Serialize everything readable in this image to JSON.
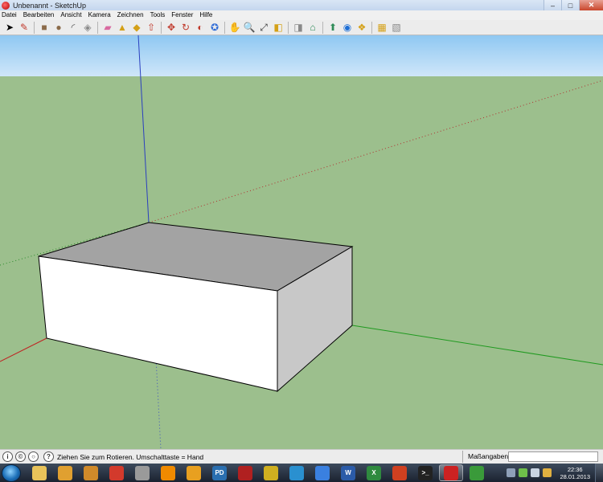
{
  "window": {
    "title": "Unbenannt - SketchUp",
    "minimize_glyph": "–",
    "maximize_glyph": "□",
    "close_glyph": "✕"
  },
  "menu": [
    "Datei",
    "Bearbeiten",
    "Ansicht",
    "Kamera",
    "Zeichnen",
    "Tools",
    "Fenster",
    "Hilfe"
  ],
  "toolbar": {
    "tools": [
      {
        "name": "select-tool-icon",
        "glyph": "➤",
        "color": "#000000"
      },
      {
        "name": "line-tool-icon",
        "glyph": "✎",
        "color": "#c0392b"
      },
      {
        "name": "rectangle-tool-icon",
        "glyph": "■",
        "color": "#8b6b4a"
      },
      {
        "name": "circle-tool-icon",
        "glyph": "●",
        "color": "#8b6b4a"
      },
      {
        "name": "arc-tool-icon",
        "glyph": "◜",
        "color": "#555555"
      },
      {
        "name": "make-component-icon",
        "glyph": "◈",
        "color": "#888888"
      },
      {
        "name": "eraser-tool-icon",
        "glyph": "▰",
        "color": "#d96aa0"
      },
      {
        "name": "tape-measure-icon",
        "glyph": "▲",
        "color": "#d4a017"
      },
      {
        "name": "paint-bucket-icon",
        "glyph": "◆",
        "color": "#d4a017"
      },
      {
        "name": "push-pull-tool-icon",
        "glyph": "⇧",
        "color": "#c0392b"
      },
      {
        "name": "move-tool-icon",
        "glyph": "✥",
        "color": "#c0392b"
      },
      {
        "name": "rotate-tool-icon",
        "glyph": "↻",
        "color": "#c0392b"
      },
      {
        "name": "offset-tool-icon",
        "glyph": "◐",
        "color": "#c0392b"
      },
      {
        "name": "orbit-tool-icon",
        "glyph": "✪",
        "color": "#2e6bd6"
      },
      {
        "name": "pan-tool-icon",
        "glyph": "✋",
        "color": "#444444"
      },
      {
        "name": "zoom-tool-icon",
        "glyph": "🔍",
        "color": "#333333"
      },
      {
        "name": "zoom-extents-icon",
        "glyph": "⤢",
        "color": "#333333"
      },
      {
        "name": "previous-view-icon",
        "glyph": "◧",
        "color": "#d4a017"
      },
      {
        "name": "next-view-icon",
        "glyph": "◨",
        "color": "#888888"
      },
      {
        "name": "get-models-icon",
        "glyph": "⌂",
        "color": "#2e8b57"
      },
      {
        "name": "share-model-icon",
        "glyph": "⬆",
        "color": "#2e8b57"
      },
      {
        "name": "google-earth-icon",
        "glyph": "◉",
        "color": "#1e6fd6"
      },
      {
        "name": "components-icon",
        "glyph": "❖",
        "color": "#d4a017"
      },
      {
        "name": "materials-icon",
        "glyph": "▦",
        "color": "#d4a017"
      },
      {
        "name": "styles-icon",
        "glyph": "▧",
        "color": "#888888"
      }
    ]
  },
  "statusbar": {
    "message": "Ziehen Sie zum Rotieren.  Umschalttaste = Hand",
    "measure_label": "Maßangaben",
    "measure_value": ""
  },
  "taskbar": {
    "apps": [
      {
        "name": "explorer-icon",
        "color": "#e8c35a",
        "label": ""
      },
      {
        "name": "browser-icon",
        "color": "#e0a030",
        "label": ""
      },
      {
        "name": "app-gear-icon",
        "color": "#d08a2a",
        "label": ""
      },
      {
        "name": "chrome-icon",
        "color": "#d33a2c",
        "label": ""
      },
      {
        "name": "media-disc-icon",
        "color": "#9a9a9a",
        "label": ""
      },
      {
        "name": "vlc-icon",
        "color": "#f08a00",
        "label": ""
      },
      {
        "name": "filezilla-icon",
        "color": "#e8a020",
        "label": ""
      },
      {
        "name": "pdf-icon",
        "color": "#2a6fb0",
        "label": "PD"
      },
      {
        "name": "app-red-icon",
        "color": "#b02020",
        "label": ""
      },
      {
        "name": "app-yellow-icon",
        "color": "#d0b020",
        "label": ""
      },
      {
        "name": "app-blue-icon",
        "color": "#2a90d0",
        "label": ""
      },
      {
        "name": "app-feather-icon",
        "color": "#3a80e0",
        "label": ""
      },
      {
        "name": "word-icon",
        "color": "#2b5ba8",
        "label": "W"
      },
      {
        "name": "excel-icon",
        "color": "#2f8a3f",
        "label": "X"
      },
      {
        "name": "app-fox-icon",
        "color": "#d04020",
        "label": ""
      },
      {
        "name": "terminal-icon",
        "color": "#222222",
        "label": ">_"
      },
      {
        "name": "sketchup-icon",
        "color": "#cc2222",
        "label": ""
      },
      {
        "name": "app-green-icon",
        "color": "#3a9a3a",
        "label": ""
      }
    ],
    "clock_time": "22:36",
    "clock_date": "28.01.2013"
  },
  "colors": {
    "sky_top": "#8fc8f2",
    "sky_bottom": "#cfe6f9",
    "ground": "#9cbf8d",
    "box_front": "#ffffff",
    "box_side": "#c8c8c8",
    "box_top": "#a3a3a3"
  }
}
